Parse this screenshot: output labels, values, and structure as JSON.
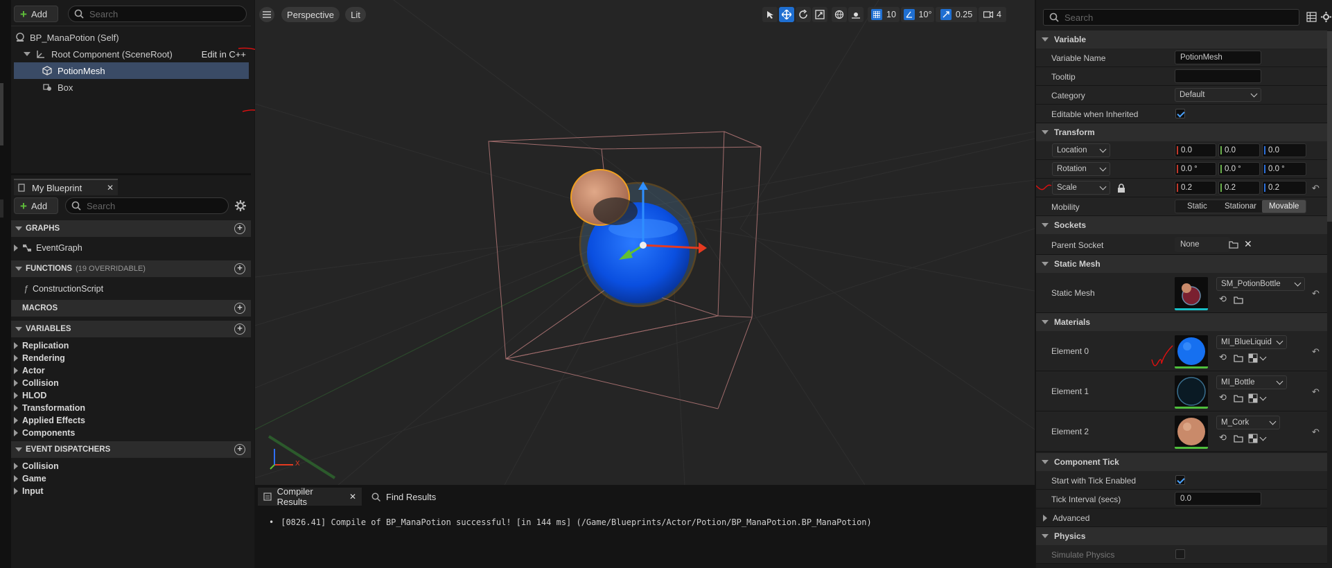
{
  "components": {
    "add_label": "Add",
    "search_placeholder": "Search",
    "self_label": "BP_ManaPotion (Self)",
    "root_label": "Root Component (SceneRoot)",
    "edit_cpp": "Edit in C++",
    "items": [
      {
        "label": "PotionMesh"
      },
      {
        "label": "Box"
      }
    ]
  },
  "my_blueprint": {
    "tab_label": "My Blueprint",
    "add_label": "Add",
    "search_placeholder": "Search",
    "graphs": {
      "title": "GRAPHS",
      "items": [
        "EventGraph"
      ]
    },
    "functions": {
      "title": "FUNCTIONS",
      "subtitle": "(19 OVERRIDABLE)",
      "items": [
        "ConstructionScript"
      ]
    },
    "macros": {
      "title": "MACROS"
    },
    "variables": {
      "title": "VARIABLES",
      "items": [
        "Replication",
        "Rendering",
        "Actor",
        "Collision",
        "HLOD",
        "Transformation",
        "Applied Effects",
        "Components"
      ]
    },
    "event_dispatchers": {
      "title": "EVENT DISPATCHERS",
      "items": [
        "Collision",
        "Game",
        "Input"
      ]
    }
  },
  "viewport": {
    "perspective": "Perspective",
    "lit": "Lit",
    "grid_snap": "10",
    "rot_snap": "10°",
    "scale_snap": "0.25",
    "cam_speed": "4",
    "axis_x": "X"
  },
  "compiler": {
    "tab_results": "Compiler Results",
    "tab_find": "Find Results",
    "message": "[0826.41] Compile of BP_ManaPotion successful! [in 144 ms] (/Game/Blueprints/Actor/Potion/BP_ManaPotion.BP_ManaPotion)"
  },
  "details": {
    "search_placeholder": "Search",
    "variable": {
      "title": "Variable",
      "name_label": "Variable Name",
      "name_value": "PotionMesh",
      "tooltip_label": "Tooltip",
      "tooltip_value": "",
      "category_label": "Category",
      "category_value": "Default",
      "editable_label": "Editable when Inherited"
    },
    "transform": {
      "title": "Transform",
      "location": "Location",
      "rotation": "Rotation",
      "scale": "Scale",
      "loc": [
        "0.0",
        "0.0",
        "0.0"
      ],
      "rot": [
        "0.0 °",
        "0.0 °",
        "0.0 °"
      ],
      "scl": [
        "0.2",
        "0.2",
        "0.2"
      ],
      "mobility_label": "Mobility",
      "mobility_options": [
        "Static",
        "Stationar",
        "Movable"
      ]
    },
    "sockets": {
      "title": "Sockets",
      "parent_label": "Parent Socket",
      "parent_value": "None"
    },
    "static_mesh": {
      "title": "Static Mesh",
      "label": "Static Mesh",
      "value": "SM_PotionBottle"
    },
    "materials": {
      "title": "Materials",
      "elements": [
        {
          "label": "Element 0",
          "value": "MI_BlueLiquid"
        },
        {
          "label": "Element 1",
          "value": "MI_Bottle"
        },
        {
          "label": "Element 2",
          "value": "M_Cork"
        }
      ]
    },
    "component_tick": {
      "title": "Component Tick",
      "start_label": "Start with Tick Enabled",
      "interval_label": "Tick Interval (secs)",
      "interval_value": "0.0",
      "advanced": "Advanced"
    },
    "physics": {
      "title": "Physics",
      "simulate_label": "Simulate Physics"
    }
  },
  "colors": {
    "accent": "#1f6fd1",
    "selection": "#3a4b66",
    "annotation": "#e01010",
    "liquid": "#0a4fe0",
    "cork": "#c98a6a",
    "bounds": "#b87a7a"
  }
}
